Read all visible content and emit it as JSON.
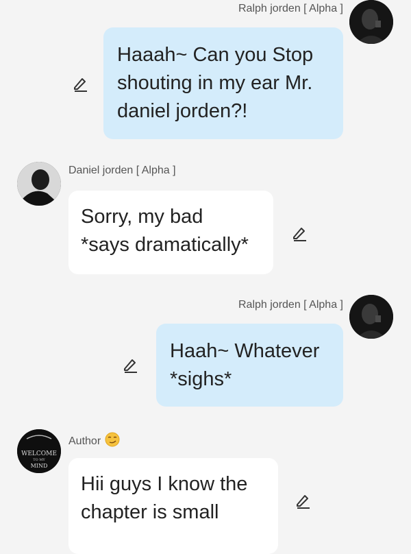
{
  "messages": [
    {
      "sender": "Ralph jorden [ Alpha ]",
      "side": "right",
      "lines": [
        "Haaah~ Can you Stop",
        "shouting in my ear Mr.",
        "daniel jorden?!"
      ],
      "avatar_icon": "avatar-ralph"
    },
    {
      "sender": "Daniel jorden [ Alpha ]",
      "side": "left",
      "lines": [
        "Sorry, my bad",
        "*says dramatically*"
      ],
      "avatar_icon": "avatar-daniel"
    },
    {
      "sender": "Ralph jorden [ Alpha ]",
      "side": "right",
      "lines": [
        "Haah~ Whatever",
        "*sighs*"
      ],
      "avatar_icon": "avatar-ralph"
    },
    {
      "sender": "Author",
      "side": "left",
      "lines": [
        "Hii guys I know the",
        "chapter is small"
      ],
      "avatar_icon": "avatar-author",
      "avatar_text": [
        "WELCOME",
        "TO MY",
        "MIND"
      ],
      "sender_emoji": "smirk-emoji"
    }
  ],
  "icons": {
    "edit": "pencil-icon"
  },
  "colors": {
    "right_bubble": "#d4ecfb",
    "left_bubble": "#ffffff",
    "background": "#f4f4f4"
  }
}
